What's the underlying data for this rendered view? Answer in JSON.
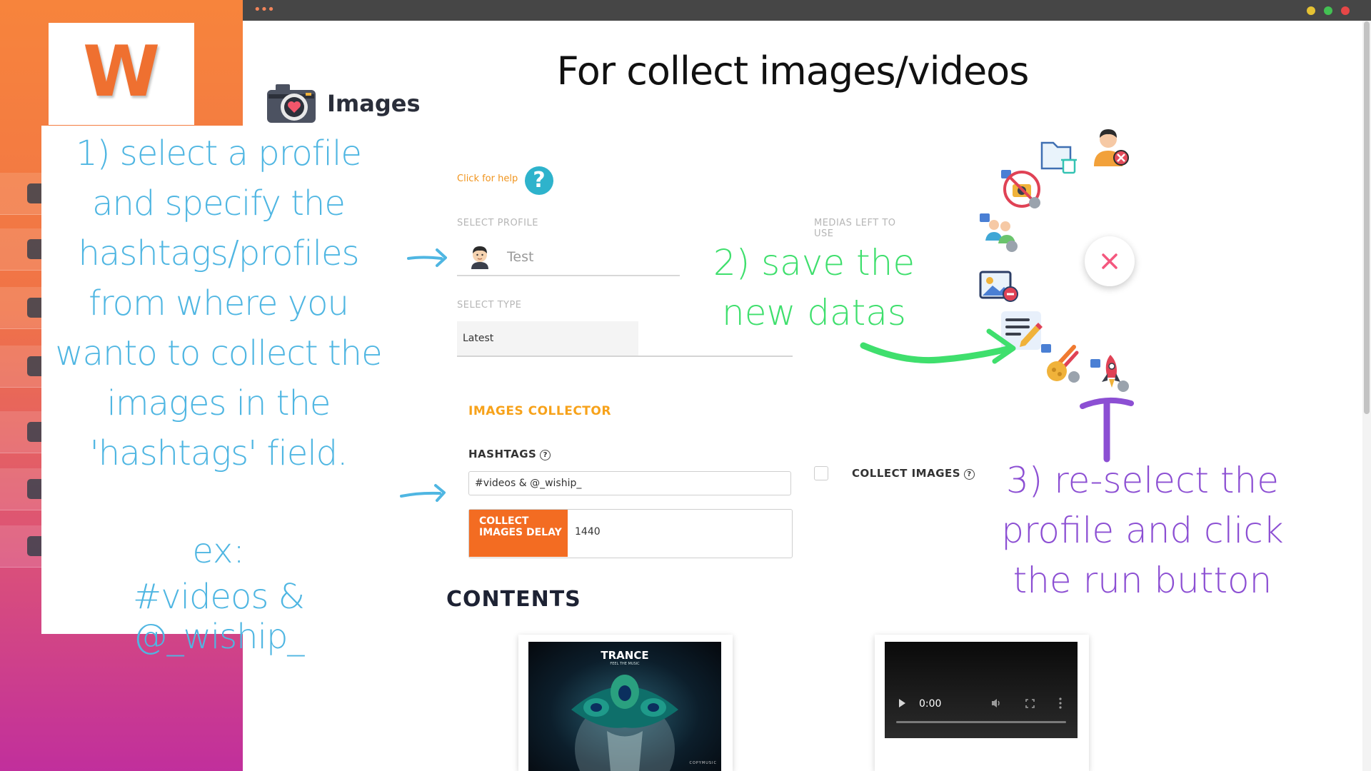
{
  "window": {
    "menu_dots": "•••"
  },
  "sidebar": {
    "logo_letter": "W"
  },
  "page": {
    "title": "For collect images/videos",
    "section_title": "Images"
  },
  "help": {
    "link_text": "Click for help",
    "icon_glyph": "?"
  },
  "form": {
    "select_profile_label": "SELECT PROFILE",
    "medias_left_label": "MEDIAS LEFT TO USE",
    "profile_value": "Test",
    "select_type_label": "SELECT TYPE",
    "type_value": "Latest",
    "collector_title": "IMAGES COLLECTOR",
    "hashtags_label": "HASHTAGS",
    "help_glyph": "?",
    "hashtags_value": "#videos & @_wiship_",
    "delay_label": "COLLECT IMAGES DELAY",
    "delay_value": "1440",
    "collect_images_label": "COLLECT IMAGES",
    "collect_images_checked": false
  },
  "contents": {
    "title": "CONTENTS",
    "thumbnail": {
      "title": "TRANCE",
      "subtitle": "FEEL THE MUSIC",
      "brand": "COPYMUSIC"
    },
    "video": {
      "time": "0:00"
    }
  },
  "floating_icons": [
    "delete-folder-icon",
    "remove-user-icon",
    "no-camera-icon",
    "group-media-icon",
    "remove-image-icon",
    "edit-note-icon",
    "meteor-media-icon",
    "rocket-media-icon",
    "close-icon"
  ],
  "annotations": {
    "step1": "1) select a profile and specify the hashtags/profiles from where you wanto to collect the images in the 'hashtags' field.",
    "step1_example_label": "ex:",
    "step1_example_value": "#videos & @_wiship_",
    "step2": "2) save the new datas",
    "step3": "3) re-select the profile and click the run button"
  },
  "colors": {
    "accent_orange": "#f36c22",
    "annotation_blue": "#4fb6e2",
    "annotation_green": "#3fdf6d",
    "annotation_purple": "#8c4fd3",
    "help_teal": "#2eb3cc"
  }
}
